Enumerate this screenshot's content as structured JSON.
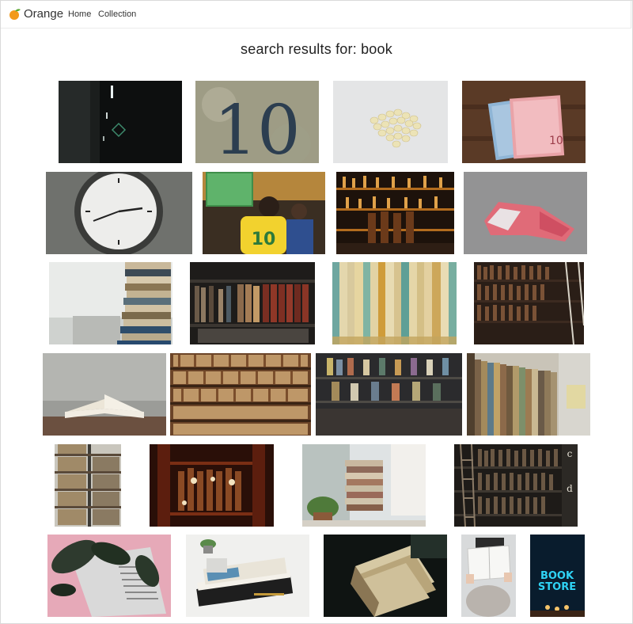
{
  "nav": {
    "brand": "Orange",
    "links": [
      "Home",
      "Collection"
    ]
  },
  "page": {
    "title": "search results for: book"
  },
  "photos": [
    {
      "subject": "dark corridor with lights"
    },
    {
      "subject": "painted number 10 on wall"
    },
    {
      "subject": "pills on white"
    },
    {
      "subject": "euro banknotes on wood"
    },
    {
      "subject": "wall clock"
    },
    {
      "subject": "football fans in yellow jersey 10"
    },
    {
      "subject": "bar shelves with bottles"
    },
    {
      "subject": "crumpled banknote on asphalt"
    },
    {
      "subject": "stack of books"
    },
    {
      "subject": "library shelves"
    },
    {
      "subject": "book spines close-up"
    },
    {
      "subject": "tall bookcase with ladder"
    },
    {
      "subject": "open book on table"
    },
    {
      "subject": "wall of bookshelves"
    },
    {
      "subject": "bookstore interior"
    },
    {
      "subject": "library aisle"
    },
    {
      "subject": "narrow bookshelf"
    },
    {
      "subject": "warm lit bookcase"
    },
    {
      "subject": "books by window with plant"
    },
    {
      "subject": "bookcase with ladder c d"
    },
    {
      "subject": "magazine with plant leaves"
    },
    {
      "subject": "CSS book on desk"
    },
    {
      "subject": "old books pile"
    },
    {
      "subject": "person holding notebook"
    },
    {
      "subject": "neon book store sign"
    }
  ],
  "overlay_text": {
    "number_ten": "10",
    "jersey_number": "10",
    "store_sign_line1": "BOOK",
    "store_sign_line2": "STORE",
    "shelf_letter_c": "c",
    "shelf_letter_d": "d"
  }
}
